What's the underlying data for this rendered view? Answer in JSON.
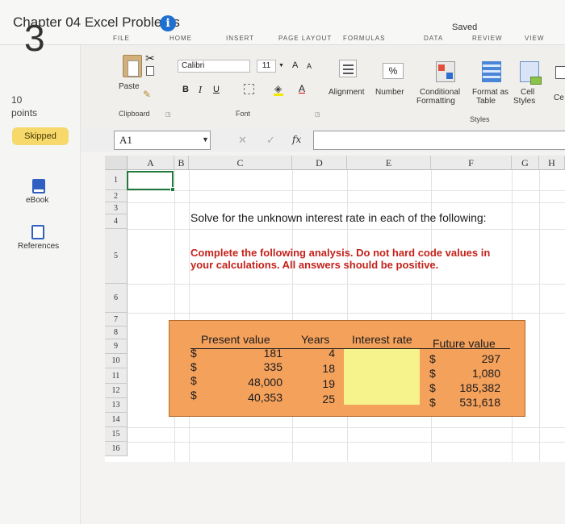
{
  "header": {
    "title": "Chapter 04 Excel Problems",
    "info_icon": "info-icon",
    "saved_status": "Saved"
  },
  "side": {
    "question_number": "3",
    "points_value": "10",
    "points_label": "points",
    "badge": "Skipped",
    "ebook_label": "eBook",
    "references_label": "References"
  },
  "ribbon": {
    "tabs": [
      "FILE",
      "HOME",
      "INSERT",
      "PAGE LAYOUT",
      "FORMULAS",
      "DATA",
      "REVIEW",
      "VIEW"
    ],
    "paste_label": "Paste",
    "clipboard_group": "Clipboard",
    "font_name": "Calibri",
    "font_size": "11",
    "bold": "B",
    "italic": "I",
    "underline": "U",
    "grow_font": "A",
    "shrink_font": "A",
    "font_color_glyph": "A",
    "font_group": "Font",
    "alignment_label": "Alignment",
    "number_label": "Number",
    "number_glyph": "%",
    "conditional_label_1": "Conditional",
    "conditional_label_2": "Formatting",
    "format_table_1": "Format as",
    "format_table_2": "Table",
    "cell_styles_1": "Cell",
    "cell_styles_2": "Styles",
    "styles_group": "Styles",
    "cells_partial": "Ce"
  },
  "formula_bar": {
    "name_box": "A1",
    "fx": "fx",
    "cancel_glyph": "✕",
    "enter_glyph": "✓",
    "value": ""
  },
  "sheet": {
    "columns": [
      "A",
      "B",
      "C",
      "D",
      "E",
      "F",
      "G",
      "H"
    ],
    "rows": [
      "1",
      "2",
      "3",
      "4",
      "5",
      "6",
      "7",
      "8",
      "9",
      "10",
      "11",
      "12",
      "13",
      "14",
      "15",
      "16"
    ],
    "question": "Solve for the unknown interest rate in each of the following:",
    "instructions": "Complete the following analysis. Do not hard code values in your calculations. All answers should be positive.",
    "table": {
      "headers": [
        "Present value",
        "Years",
        "Interest rate",
        "Future value"
      ],
      "currency": "$",
      "rows": [
        {
          "pv": "181",
          "years": "4",
          "fv": "297"
        },
        {
          "pv": "335",
          "years": "18",
          "fv": "1,080"
        },
        {
          "pv": "48,000",
          "years": "19",
          "fv": "185,382"
        },
        {
          "pv": "40,353",
          "years": "25",
          "fv": "531,618"
        }
      ],
      "answer_fill": "#f6f28c",
      "block_fill": "#f4a15c"
    }
  },
  "colors": {
    "accent": "#1f6fd1",
    "selection": "#1f7a3c",
    "instruction_red": "#c4221b",
    "skipped_badge": "#f6d86b"
  }
}
